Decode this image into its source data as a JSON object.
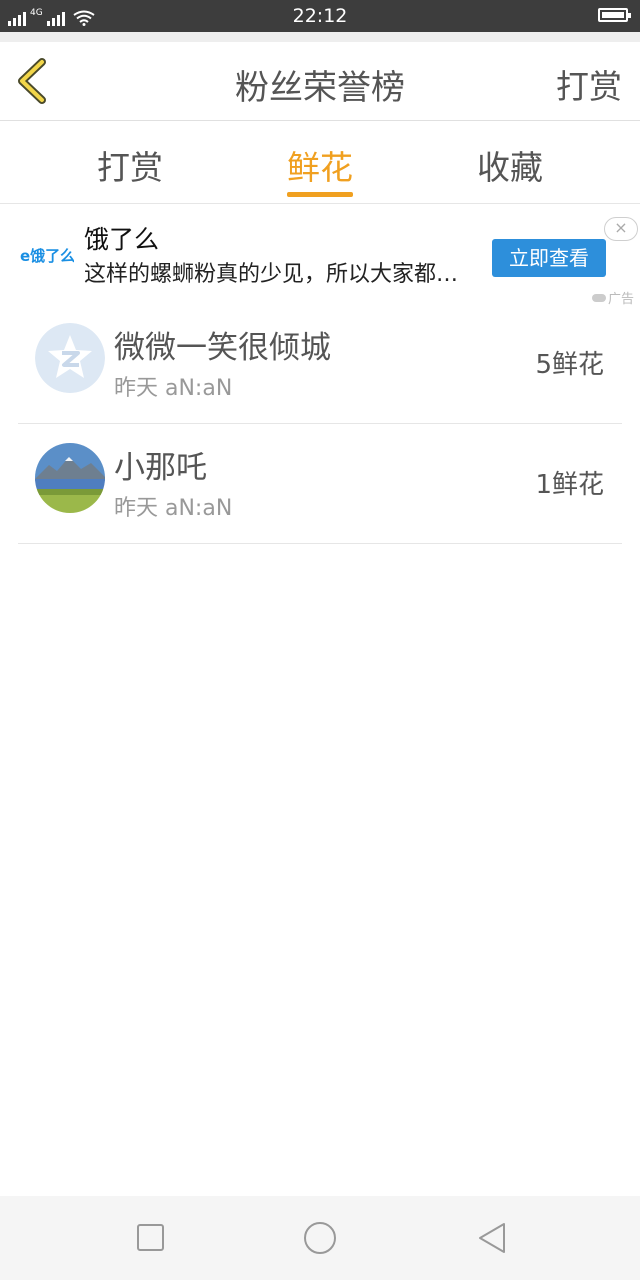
{
  "status_bar": {
    "time": "22:12",
    "network": "4G"
  },
  "header": {
    "title": "粉丝荣誉榜",
    "action_label": "打赏"
  },
  "tabs": [
    {
      "label": "打赏",
      "active": false
    },
    {
      "label": "鲜花",
      "active": true
    },
    {
      "label": "收藏",
      "active": false
    }
  ],
  "ad": {
    "logo_text": "e饿了么",
    "brand": "饿了么",
    "description": "这样的螺蛳粉真的少见，所以大家都…",
    "cta_label": "立即查看",
    "close_symbol": "×",
    "tag": "广告"
  },
  "list": [
    {
      "name": "微微一笑很倾城",
      "time": "昨天 aN:aN",
      "count": "5鲜花",
      "avatar": "qzone-logo-icon"
    },
    {
      "name": "小那吒",
      "time": "昨天 aN:aN",
      "count": "1鲜花",
      "avatar": "landscape-photo"
    }
  ],
  "colors": {
    "accent": "#f0a020",
    "cta": "#2d8fdb",
    "status_bar": "#3d3d3d"
  }
}
